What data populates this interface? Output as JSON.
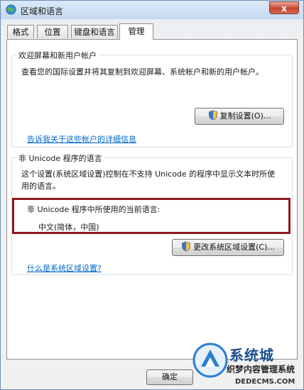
{
  "window": {
    "title": "区域和语言",
    "close_label": "x"
  },
  "tabs": [
    {
      "label": "格式"
    },
    {
      "label": "位置"
    },
    {
      "label": "键盘和语言"
    },
    {
      "label": "管理"
    }
  ],
  "welcome_group": {
    "title": "欢迎屏幕和新用户帐户",
    "description": "查看您的国际设置并将其复制到欢迎屏幕、系统帐户和新的用户帐户。",
    "copy_button": "复制设置(O)...",
    "link": "告诉我关于这些帐户的详细信息"
  },
  "unicode_group": {
    "title": "非 Unicode 程序的语言",
    "description_line1": "这个设置(系统区域设置)控制在不支持 Unicode 的程序中显示文本时所使",
    "description_line2": "用的语言。",
    "current_label": "非 Unicode 程序中所使用的当前语言:",
    "current_value": "中文(简体，中国)",
    "change_button": "更改系统区域设置(C)...",
    "link": "什么是系统区域设置?"
  },
  "footer": {
    "ok_button": "确定"
  },
  "watermark": {
    "brand": "系统城",
    "line": "织梦内容管理系统",
    "url": "DEDECMS.COM"
  },
  "colors": {
    "highlight_border": "#8b1a1e",
    "link": "#0066cc"
  }
}
